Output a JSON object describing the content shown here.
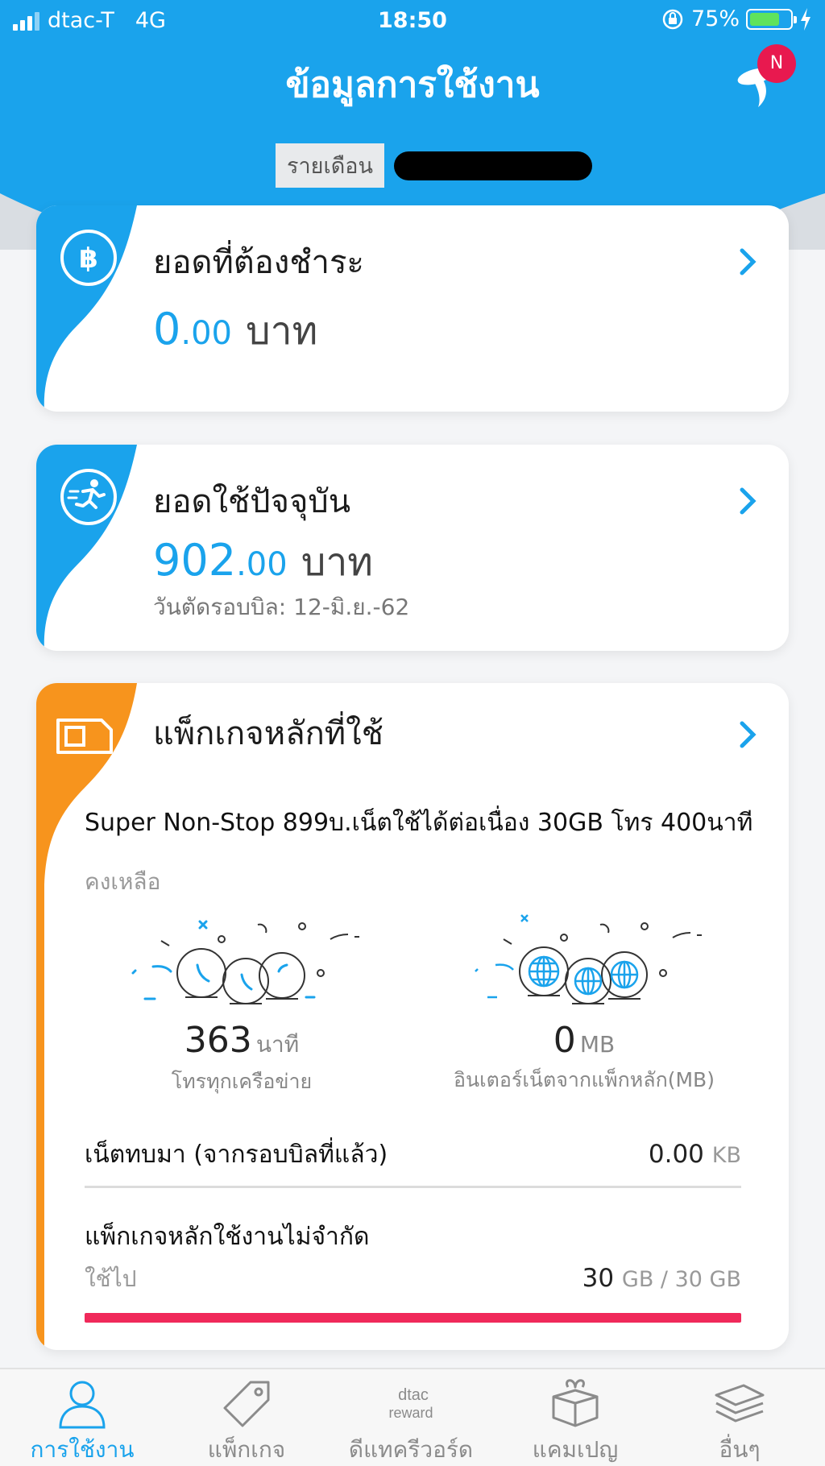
{
  "status_bar": {
    "carrier": "dtac-T",
    "network": "4G",
    "time": "18:50",
    "battery_percent": "75%",
    "battery_level": 0.75
  },
  "header": {
    "title": "ข้อมูลการใช้งาน",
    "notification_badge": "N",
    "account_type": "รายเดือน"
  },
  "bill_due": {
    "title": "ยอดที่ต้องชำระ",
    "amount_int": "0",
    "amount_dec": ".00",
    "unit": "บาท"
  },
  "current_usage": {
    "title": "ยอดใช้ปัจจุบัน",
    "amount_int": "902",
    "amount_dec": ".00",
    "unit": "บาท",
    "cycle_date": "วันตัดรอบบิล: 12-มิ.ย.-62"
  },
  "main_package": {
    "title": "แพ็กเกจหลักที่ใช้",
    "name": "Super Non-Stop 899บ.เน็ตใช้ได้ต่อเนื่อง 30GB โทร 400นาที",
    "remaining_label": "คงเหลือ",
    "call": {
      "value": "363",
      "unit": "นาที",
      "label": "โทรทุกเครือข่าย"
    },
    "internet": {
      "value": "0",
      "unit": "MB",
      "label": "อินเตอร์เน็ตจากแพ็กหลัก(MB)"
    },
    "rollover": {
      "label": "เน็ตทบมา (จากรอบบิลที่แล้ว)",
      "value": "0.00",
      "unit": "KB"
    },
    "unlimited": {
      "title": "แพ็กเกจหลักใช้งานไม่จำกัด",
      "used_label": "ใช้ไป",
      "used_value": "30",
      "used_unit": "GB / 30 GB",
      "used_fraction": 1.0
    }
  },
  "bottom_nav": [
    {
      "label": "การใช้งาน",
      "icon": "person-icon",
      "active": true
    },
    {
      "label": "แพ็กเกจ",
      "icon": "tag-icon",
      "active": false
    },
    {
      "label": "ดีแทครีวอร์ด",
      "icon": "dtac-reward-icon",
      "active": false,
      "icon_text": "dtac",
      "icon_subtext": "reward"
    },
    {
      "label": "แคมเปญ",
      "icon": "gift-box-icon",
      "active": false
    },
    {
      "label": "อื่นๆ",
      "icon": "stack-icon",
      "active": false
    }
  ],
  "colors": {
    "primary_blue": "#1aa3ec",
    "package_orange": "#f7941d",
    "progress_red": "#f0295a"
  }
}
